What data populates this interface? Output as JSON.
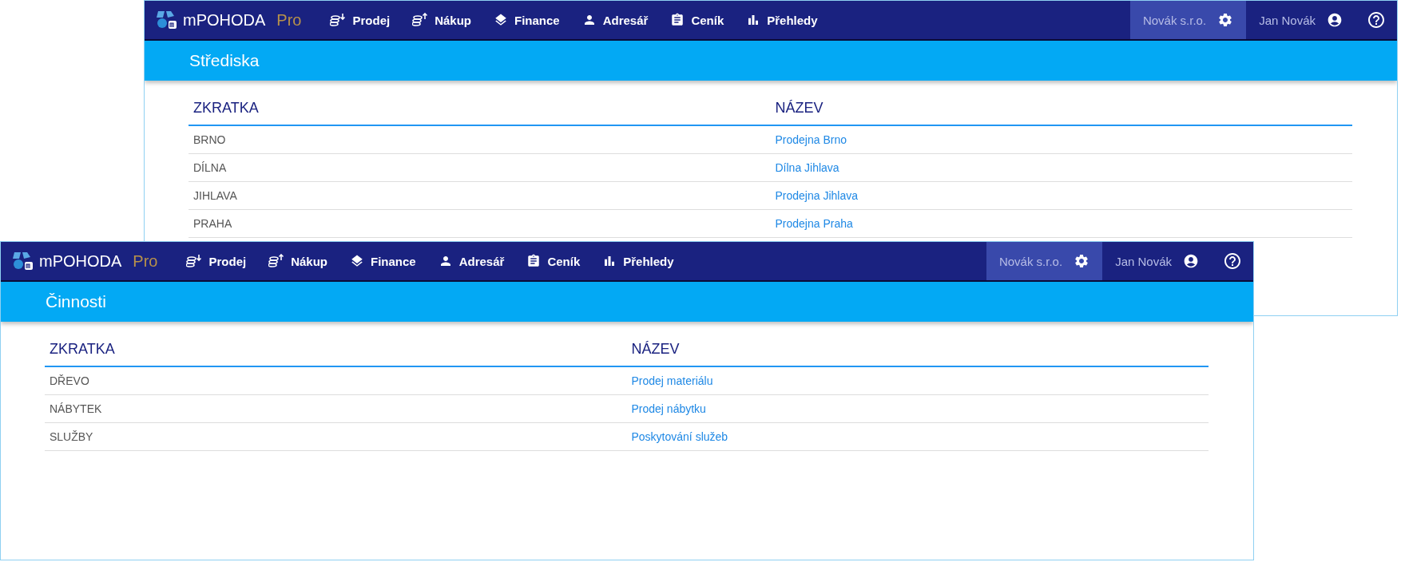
{
  "windows": [
    {
      "app": {
        "logo_name": "mPOHODA",
        "logo_suffix": "Pro"
      },
      "menu": [
        {
          "label": "Prodej"
        },
        {
          "label": "Nákup"
        },
        {
          "label": "Finance"
        },
        {
          "label": "Adresář"
        },
        {
          "label": "Ceník"
        },
        {
          "label": "Přehledy"
        }
      ],
      "account": [
        {
          "label": "Novák s.r.o.",
          "selected": true
        },
        {
          "label": "Jan Novák",
          "selected": false
        }
      ],
      "page_title": "Střediska",
      "table": {
        "columns": [
          "ZKRATKA",
          "NÁZEV"
        ],
        "rows": [
          [
            "BRNO",
            "Prodejna Brno"
          ],
          [
            "DÍLNA",
            "Dílna Jihlava"
          ],
          [
            "JIHLAVA",
            "Prodejna Jihlava"
          ],
          [
            "PRAHA",
            "Prodejna Praha"
          ]
        ]
      }
    },
    {
      "app": {
        "logo_name": "mPOHODA",
        "logo_suffix": "Pro"
      },
      "menu": [
        {
          "label": "Prodej"
        },
        {
          "label": "Nákup"
        },
        {
          "label": "Finance"
        },
        {
          "label": "Adresář"
        },
        {
          "label": "Ceník"
        },
        {
          "label": "Přehledy"
        }
      ],
      "account": [
        {
          "label": "Novák s.r.o.",
          "selected": true
        },
        {
          "label": "Jan Novák",
          "selected": false
        }
      ],
      "page_title": "Činnosti",
      "table": {
        "columns": [
          "ZKRATKA",
          "NÁZEV"
        ],
        "rows": [
          [
            "DŘEVO",
            "Prodej materiálu"
          ],
          [
            "NÁBYTEK",
            "Prodej nábytku"
          ],
          [
            "SLUŽBY",
            "Poskytování služeb"
          ]
        ]
      }
    }
  ]
}
